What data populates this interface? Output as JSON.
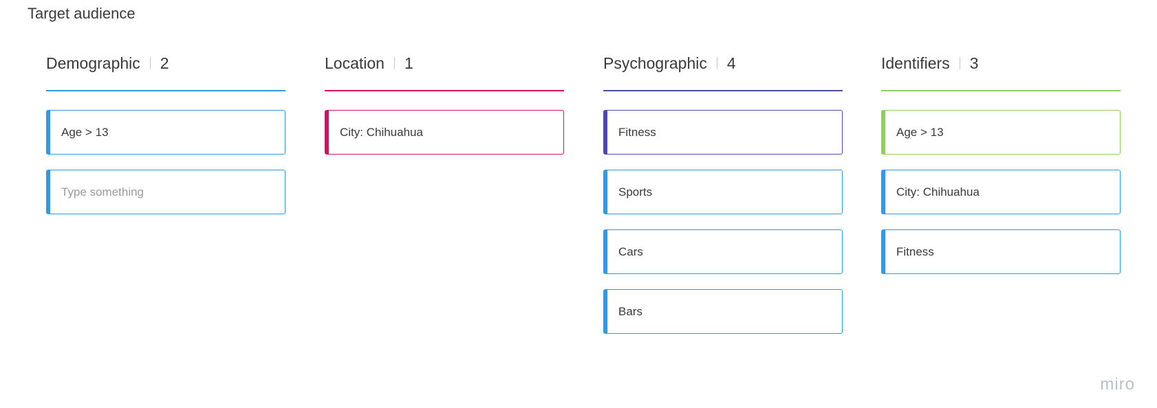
{
  "board": {
    "title": "Target audience"
  },
  "columns": [
    {
      "title": "Demographic",
      "count": "2",
      "color": "#2d9be8",
      "cards": [
        {
          "text": "Age > 13",
          "placeholder": false,
          "accent": "#2d9be8"
        },
        {
          "text": "Type something",
          "placeholder": true,
          "accent": "#2d9be8"
        }
      ]
    },
    {
      "title": "Location",
      "count": "1",
      "color": "#d1135f",
      "cards": [
        {
          "text": "City: Chihuahua",
          "placeholder": false,
          "accent": "#d1135f"
        }
      ]
    },
    {
      "title": "Psychographic",
      "count": "4",
      "color": "#4a4aa8",
      "cards": [
        {
          "text": "Fitness",
          "placeholder": false,
          "accent": "#4a4aa8"
        },
        {
          "text": "Sports",
          "placeholder": false,
          "accent": "#2d9be8"
        },
        {
          "text": "Cars",
          "placeholder": false,
          "accent": "#2d9be8"
        },
        {
          "text": "Bars",
          "placeholder": false,
          "accent": "#2d9be8"
        }
      ]
    },
    {
      "title": "Identifiers",
      "count": "3",
      "color": "#8ccf5a",
      "cards": [
        {
          "text": "Age > 13",
          "placeholder": false,
          "accent": "#8ccf5a"
        },
        {
          "text": "City: Chihuahua",
          "placeholder": false,
          "accent": "#2d9be8"
        },
        {
          "text": "Fitness",
          "placeholder": false,
          "accent": "#2d9be8"
        }
      ]
    }
  ],
  "watermark": {
    "text": "miro"
  }
}
